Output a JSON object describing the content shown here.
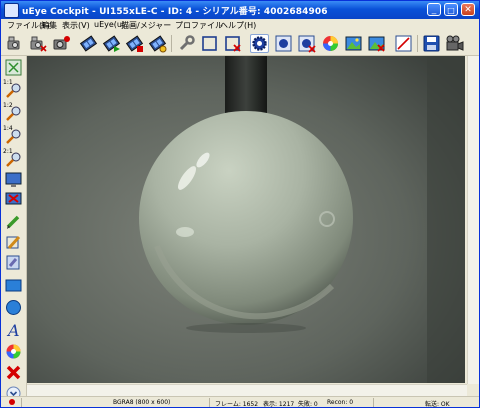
{
  "window": {
    "title": "uEye Cockpit - UI155xLE-C - ID: 4 - シリアル番号: 4002684906",
    "minimize": "_",
    "maximize": "□",
    "close": "✕"
  },
  "menu": {
    "items": [
      "ファイル(F)",
      "編集",
      "表示(V)",
      "uEye(u)",
      "描画/メジャー",
      "プロファイル",
      "ヘルプ(H)"
    ]
  },
  "toolbar": {
    "icons": [
      "camera-open-icon",
      "camera-close-icon",
      "camera-record-icon",
      "film-icon",
      "film-play-icon",
      "film-stop-icon",
      "film-snap-icon",
      "wrench-icon",
      "aoi-icon",
      "aoi-delete-icon",
      "gear-icon",
      "focus-icon",
      "focus-delete-icon",
      "color-wheel-icon",
      "image-icon",
      "image-delete-icon",
      "measure-icon",
      "save-icon",
      "movie-camera-icon"
    ]
  },
  "left_toolbar": {
    "labels": [
      "1:1",
      "1:2",
      "1:4",
      "2:1"
    ],
    "icons": [
      "fit-window-icon",
      "zoom-1-1-icon",
      "zoom-1-2-icon",
      "zoom-1-4-icon",
      "zoom-2-1-icon",
      "display-icon",
      "display-delete-icon",
      "pencil-icon",
      "brush-icon",
      "pipette-icon",
      "rectangle-icon",
      "circle-icon",
      "text-icon",
      "palette-icon",
      "delete-icon",
      "scroll-down-icon"
    ]
  },
  "status": {
    "format": "BGRA8 (800 x 600)",
    "frame": "フレーム: 1652",
    "display": "表示: 1217",
    "lost": "失敗: 0",
    "recon": "Recon: 0",
    "transfer": "転送: OK"
  },
  "colors": {
    "title_blue": "#0a52d8",
    "xp_face": "#ece9d8",
    "record_red": "#d40000"
  }
}
